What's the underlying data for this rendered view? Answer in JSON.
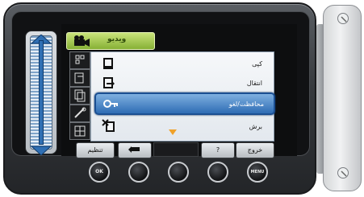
{
  "menu": {
    "tab_label": "ویدیو"
  },
  "items": [
    {
      "icon": "copy-icon",
      "label": "کپی"
    },
    {
      "icon": "move-icon",
      "label": "انتقال"
    },
    {
      "icon": "protect-key-icon",
      "label": "محافظت/لغو"
    },
    {
      "icon": "trim-icon",
      "label": "برش"
    }
  ],
  "bottom_bar": {
    "settings": "تنظیم",
    "back_icon": "return-arrow-icon",
    "help": "?",
    "exit": "خروج"
  },
  "hw_buttons": {
    "ok": "OK",
    "menu": "MENU"
  },
  "colors": {
    "accent_green": "#86b035",
    "selected_blue": "#2e6cb4",
    "scroll_arrow": "#f0a22a"
  }
}
